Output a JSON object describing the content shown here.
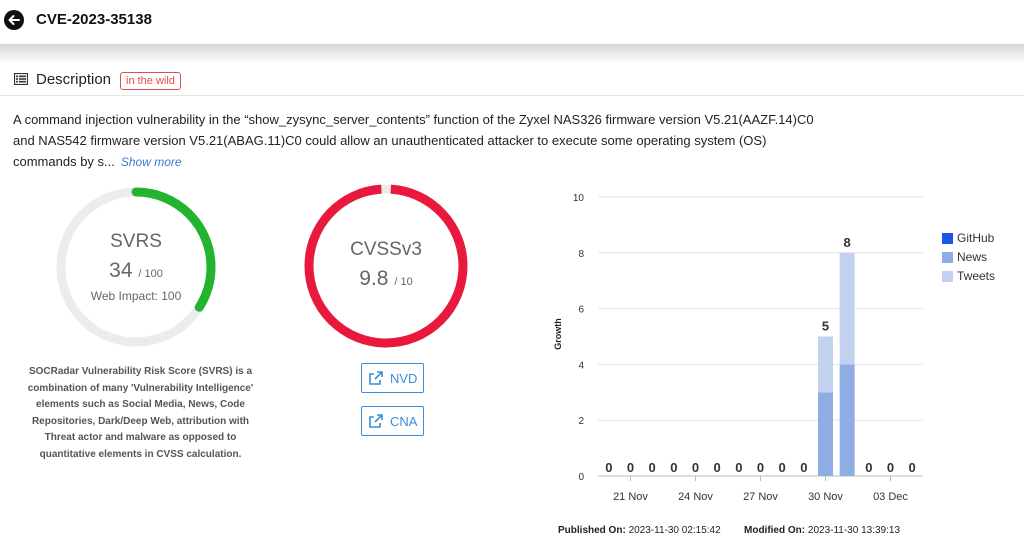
{
  "header": {
    "title": "CVE-2023-35138",
    "back_icon": "arrow-left-icon"
  },
  "description": {
    "title": "Description",
    "icon": "list-icon",
    "badge": "in the wild",
    "badge_color": "#e74c4c",
    "text_line1": "A command injection vulnerability in the “show_zysync_server_contents” function of the Zyxel NAS326 firmware version V5.21(AAZF.14)C0",
    "text_line2": "and NAS542 firmware version V5.21(ABAG.11)C0 could allow an unauthenticated attacker to execute some operating system (OS)",
    "text_line3": "commands by s...",
    "show_more": "Show more"
  },
  "svrs": {
    "title": "SVRS",
    "score": "34",
    "max": "/ 100",
    "sub": "Web Impact: 100",
    "fraction": 0.34,
    "color": "#22b32f",
    "note": "SOCRadar Vulnerability Risk Score (SVRS) is a combination of many 'Vulnerability Intelligence' elements such as Social Media, News, Code Repositories, Dark/Deep Web, attribution with Threat actor and malware as opposed to quantitative elements in CVSS calculation."
  },
  "cvss": {
    "title": "CVSSv3",
    "score": "9.8",
    "max": "/ 10",
    "fraction": 0.98,
    "color": "#e8193c"
  },
  "links": {
    "nvd_label": "NVD",
    "cna_label": "CNA",
    "icon": "external-link-icon",
    "color": "#3a8fd9"
  },
  "chart_data": {
    "type": "bar",
    "stacked": true,
    "ylabel": "Growth",
    "ylim": [
      0,
      10
    ],
    "yticks": [
      0,
      2,
      4,
      6,
      8,
      10
    ],
    "grid": true,
    "x_tick_labels": [
      "21 Nov",
      "24 Nov",
      "27 Nov",
      "30 Nov",
      "03 Dec"
    ],
    "categories": [
      "20 Nov",
      "21 Nov",
      "22 Nov",
      "23 Nov",
      "24 Nov",
      "25 Nov",
      "26 Nov",
      "27 Nov",
      "28 Nov",
      "29 Nov",
      "30 Nov",
      "01 Dec",
      "02 Dec",
      "03 Dec",
      "04 Dec"
    ],
    "totals": [
      0,
      0,
      0,
      0,
      0,
      0,
      0,
      0,
      0,
      0,
      5,
      8,
      0,
      0,
      0
    ],
    "series": [
      {
        "name": "GitHub",
        "color": "#1a56e8",
        "values": [
          0,
          0,
          0,
          0,
          0,
          0,
          0,
          0,
          0,
          0,
          0,
          0,
          0,
          0,
          0
        ]
      },
      {
        "name": "News",
        "color": "#8eaee3",
        "values": [
          0,
          0,
          0,
          0,
          0,
          0,
          0,
          0,
          0,
          0,
          3,
          4,
          0,
          0,
          0
        ]
      },
      {
        "name": "Tweets",
        "color": "#c2d2ee",
        "values": [
          0,
          0,
          0,
          0,
          0,
          0,
          0,
          0,
          0,
          0,
          2,
          4,
          0,
          0,
          0
        ]
      }
    ],
    "legend_position": "right"
  },
  "footer": {
    "published_label": "Published On:",
    "published_value": "2023-11-30 02:15:42",
    "modified_label": "Modified On:",
    "modified_value": "2023-11-30 13:39:13"
  }
}
